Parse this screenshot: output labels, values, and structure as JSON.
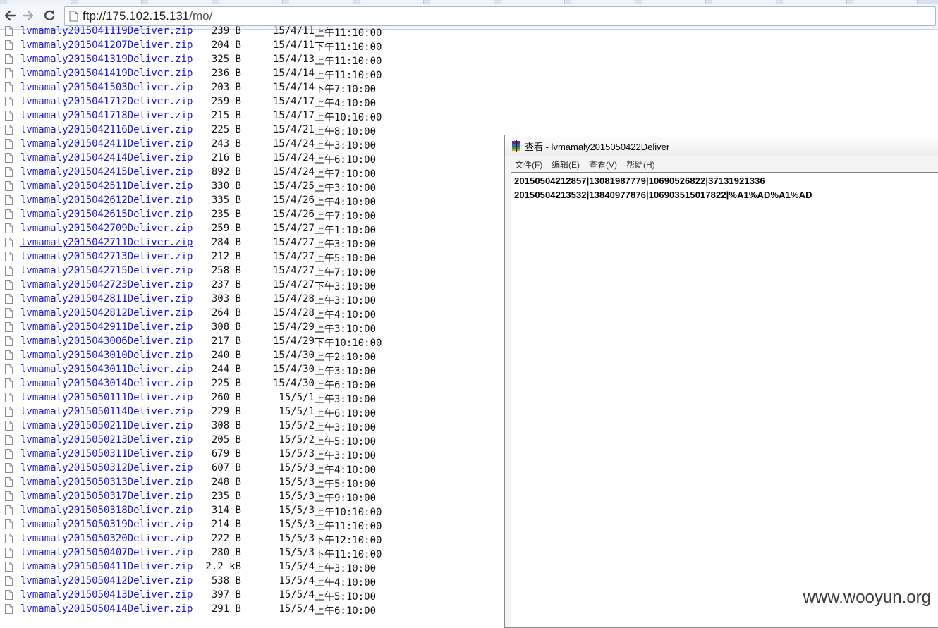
{
  "browser": {
    "url_host": "ftp://175.102.15.131",
    "url_path": "/mo/"
  },
  "listing": [
    {
      "name": "lvmamaly2015041119Deliver.zip",
      "size": "239 B",
      "date": "15/4/11",
      "time": "上午11:10:00"
    },
    {
      "name": "lvmamaly2015041207Deliver.zip",
      "size": "204 B",
      "date": "15/4/11",
      "time": "下午11:10:00"
    },
    {
      "name": "lvmamaly2015041319Deliver.zip",
      "size": "325 B",
      "date": "15/4/13",
      "time": "上午11:10:00"
    },
    {
      "name": "lvmamaly2015041419Deliver.zip",
      "size": "236 B",
      "date": "15/4/14",
      "time": "上午11:10:00"
    },
    {
      "name": "lvmamaly2015041503Deliver.zip",
      "size": "203 B",
      "date": "15/4/14",
      "time": "下午7:10:00"
    },
    {
      "name": "lvmamaly2015041712Deliver.zip",
      "size": "259 B",
      "date": "15/4/17",
      "time": "上午4:10:00"
    },
    {
      "name": "lvmamaly2015041718Deliver.zip",
      "size": "215 B",
      "date": "15/4/17",
      "time": "上午10:10:00"
    },
    {
      "name": "lvmamaly2015042116Deliver.zip",
      "size": "225 B",
      "date": "15/4/21",
      "time": "上午8:10:00"
    },
    {
      "name": "lvmamaly2015042411Deliver.zip",
      "size": "243 B",
      "date": "15/4/24",
      "time": "上午3:10:00"
    },
    {
      "name": "lvmamaly2015042414Deliver.zip",
      "size": "216 B",
      "date": "15/4/24",
      "time": "上午6:10:00"
    },
    {
      "name": "lvmamaly2015042415Deliver.zip",
      "size": "892 B",
      "date": "15/4/24",
      "time": "上午7:10:00"
    },
    {
      "name": "lvmamaly2015042511Deliver.zip",
      "size": "330 B",
      "date": "15/4/25",
      "time": "上午3:10:00"
    },
    {
      "name": "lvmamaly2015042612Deliver.zip",
      "size": "335 B",
      "date": "15/4/26",
      "time": "上午4:10:00"
    },
    {
      "name": "lvmamaly2015042615Deliver.zip",
      "size": "235 B",
      "date": "15/4/26",
      "time": "上午7:10:00"
    },
    {
      "name": "lvmamaly2015042709Deliver.zip",
      "size": "259 B",
      "date": "15/4/27",
      "time": "上午1:10:00"
    },
    {
      "name": "lvmamaly2015042711Deliver.zip",
      "size": "284 B",
      "date": "15/4/27",
      "time": "上午3:10:00"
    },
    {
      "name": "lvmamaly2015042713Deliver.zip",
      "size": "212 B",
      "date": "15/4/27",
      "time": "上午5:10:00"
    },
    {
      "name": "lvmamaly2015042715Deliver.zip",
      "size": "258 B",
      "date": "15/4/27",
      "time": "上午7:10:00"
    },
    {
      "name": "lvmamaly2015042723Deliver.zip",
      "size": "237 B",
      "date": "15/4/27",
      "time": "下午3:10:00"
    },
    {
      "name": "lvmamaly2015042811Deliver.zip",
      "size": "303 B",
      "date": "15/4/28",
      "time": "上午3:10:00"
    },
    {
      "name": "lvmamaly2015042812Deliver.zip",
      "size": "264 B",
      "date": "15/4/28",
      "time": "上午4:10:00"
    },
    {
      "name": "lvmamaly2015042911Deliver.zip",
      "size": "308 B",
      "date": "15/4/29",
      "time": "上午3:10:00"
    },
    {
      "name": "lvmamaly2015043006Deliver.zip",
      "size": "217 B",
      "date": "15/4/29",
      "time": "下午10:10:00"
    },
    {
      "name": "lvmamaly2015043010Deliver.zip",
      "size": "240 B",
      "date": "15/4/30",
      "time": "上午2:10:00"
    },
    {
      "name": "lvmamaly2015043011Deliver.zip",
      "size": "244 B",
      "date": "15/4/30",
      "time": "上午3:10:00"
    },
    {
      "name": "lvmamaly2015043014Deliver.zip",
      "size": "225 B",
      "date": "15/4/30",
      "time": "上午6:10:00"
    },
    {
      "name": "lvmamaly2015050111Deliver.zip",
      "size": "260 B",
      "date": "15/5/1",
      "time": "上午3:10:00"
    },
    {
      "name": "lvmamaly2015050114Deliver.zip",
      "size": "229 B",
      "date": "15/5/1",
      "time": "上午6:10:00"
    },
    {
      "name": "lvmamaly2015050211Deliver.zip",
      "size": "308 B",
      "date": "15/5/2",
      "time": "上午3:10:00"
    },
    {
      "name": "lvmamaly2015050213Deliver.zip",
      "size": "205 B",
      "date": "15/5/2",
      "time": "上午5:10:00"
    },
    {
      "name": "lvmamaly2015050311Deliver.zip",
      "size": "679 B",
      "date": "15/5/3",
      "time": "上午3:10:00"
    },
    {
      "name": "lvmamaly2015050312Deliver.zip",
      "size": "607 B",
      "date": "15/5/3",
      "time": "上午4:10:00"
    },
    {
      "name": "lvmamaly2015050313Deliver.zip",
      "size": "248 B",
      "date": "15/5/3",
      "time": "上午5:10:00"
    },
    {
      "name": "lvmamaly2015050317Deliver.zip",
      "size": "235 B",
      "date": "15/5/3",
      "time": "上午9:10:00"
    },
    {
      "name": "lvmamaly2015050318Deliver.zip",
      "size": "314 B",
      "date": "15/5/3",
      "time": "上午10:10:00"
    },
    {
      "name": "lvmamaly2015050319Deliver.zip",
      "size": "214 B",
      "date": "15/5/3",
      "time": "上午11:10:00"
    },
    {
      "name": "lvmamaly2015050320Deliver.zip",
      "size": "222 B",
      "date": "15/5/3",
      "time": "下午12:10:00"
    },
    {
      "name": "lvmamaly2015050407Deliver.zip",
      "size": "280 B",
      "date": "15/5/3",
      "time": "下午11:10:00"
    },
    {
      "name": "lvmamaly2015050411Deliver.zip",
      "size": "2.2 kB",
      "date": "15/5/4",
      "time": "上午3:10:00"
    },
    {
      "name": "lvmamaly2015050412Deliver.zip",
      "size": "538 B",
      "date": "15/5/4",
      "time": "上午4:10:00"
    },
    {
      "name": "lvmamaly2015050413Deliver.zip",
      "size": "397 B",
      "date": "15/5/4",
      "time": "上午5:10:00"
    },
    {
      "name": "lvmamaly2015050414Deliver.zip",
      "size": "291 B",
      "date": "15/5/4",
      "time": "上午6:10:00"
    }
  ],
  "viewer": {
    "title": "查看 - lvmamaly2015050422Deliver",
    "menu": [
      "文件(F)",
      "编辑(E)",
      "查看(V)",
      "帮助(H)"
    ],
    "lines": [
      "20150504212857|13081987779|10690526822|37131921336",
      "20150504213532|13840977876|106903515017822|%A1%AD%A1%AD"
    ]
  },
  "watermark": "www.wooyun.org"
}
